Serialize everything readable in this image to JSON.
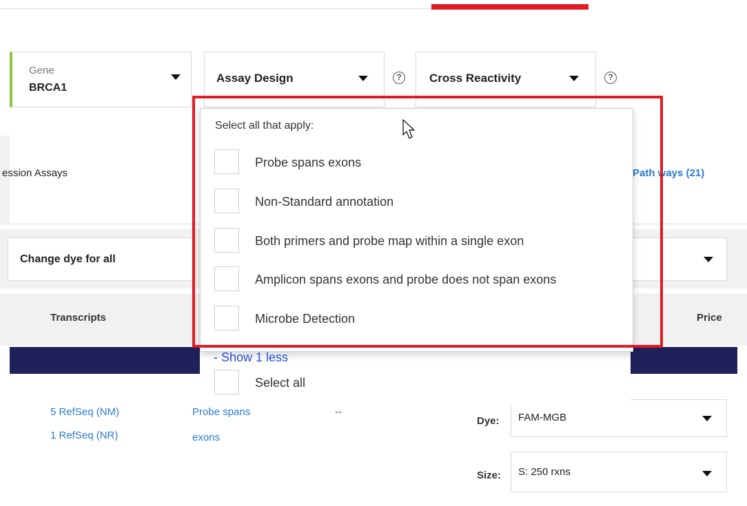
{
  "filters": {
    "gene": {
      "caption": "Gene",
      "value": "BRCA1"
    },
    "assay_design": {
      "label": "Assay Design"
    },
    "cross_reactivity": {
      "label": "Cross Reactivity"
    },
    "help_glyph": "?"
  },
  "tabs": {
    "expression_assays": "ession Assays",
    "pathways": "Path ways (21)"
  },
  "toolbar": {
    "change_dye_label": "Change dye for all"
  },
  "table": {
    "headers": {
      "transcripts": "Transcripts",
      "price": "Price"
    },
    "row": {
      "transcripts": [
        "5 RefSeq (NM)",
        "1 RefSeq (NR)"
      ],
      "probe_text_line1": "Probe spans",
      "probe_text_line2": "exons",
      "dash": "--",
      "dye_label": "Dye:",
      "dye_value": "FAM-MGB",
      "size_label": "Size:",
      "size_value": "S: 250 rxns"
    }
  },
  "dropdown": {
    "prompt": "Select all that apply:",
    "options": [
      {
        "label": "Probe spans exons",
        "checked": false
      },
      {
        "label": "Non-Standard annotation",
        "checked": false
      },
      {
        "label": "Both primers and probe map within a single exon",
        "checked": false
      },
      {
        "label": "Amplicon spans exons and probe does not span exons",
        "checked": false
      },
      {
        "label": "Microbe Detection",
        "checked": false
      }
    ],
    "show_less": "- Show 1 less",
    "select_all": "Select all"
  },
  "colors": {
    "accent_red": "#e01b22",
    "gene_accent": "#8cc63f",
    "link_blue": "#2a7bd3",
    "navy": "#20205a"
  },
  "icons": {
    "cursor": "mouse-pointer-icon",
    "chevron": "chevron-down-icon",
    "help": "help-circle-icon"
  }
}
